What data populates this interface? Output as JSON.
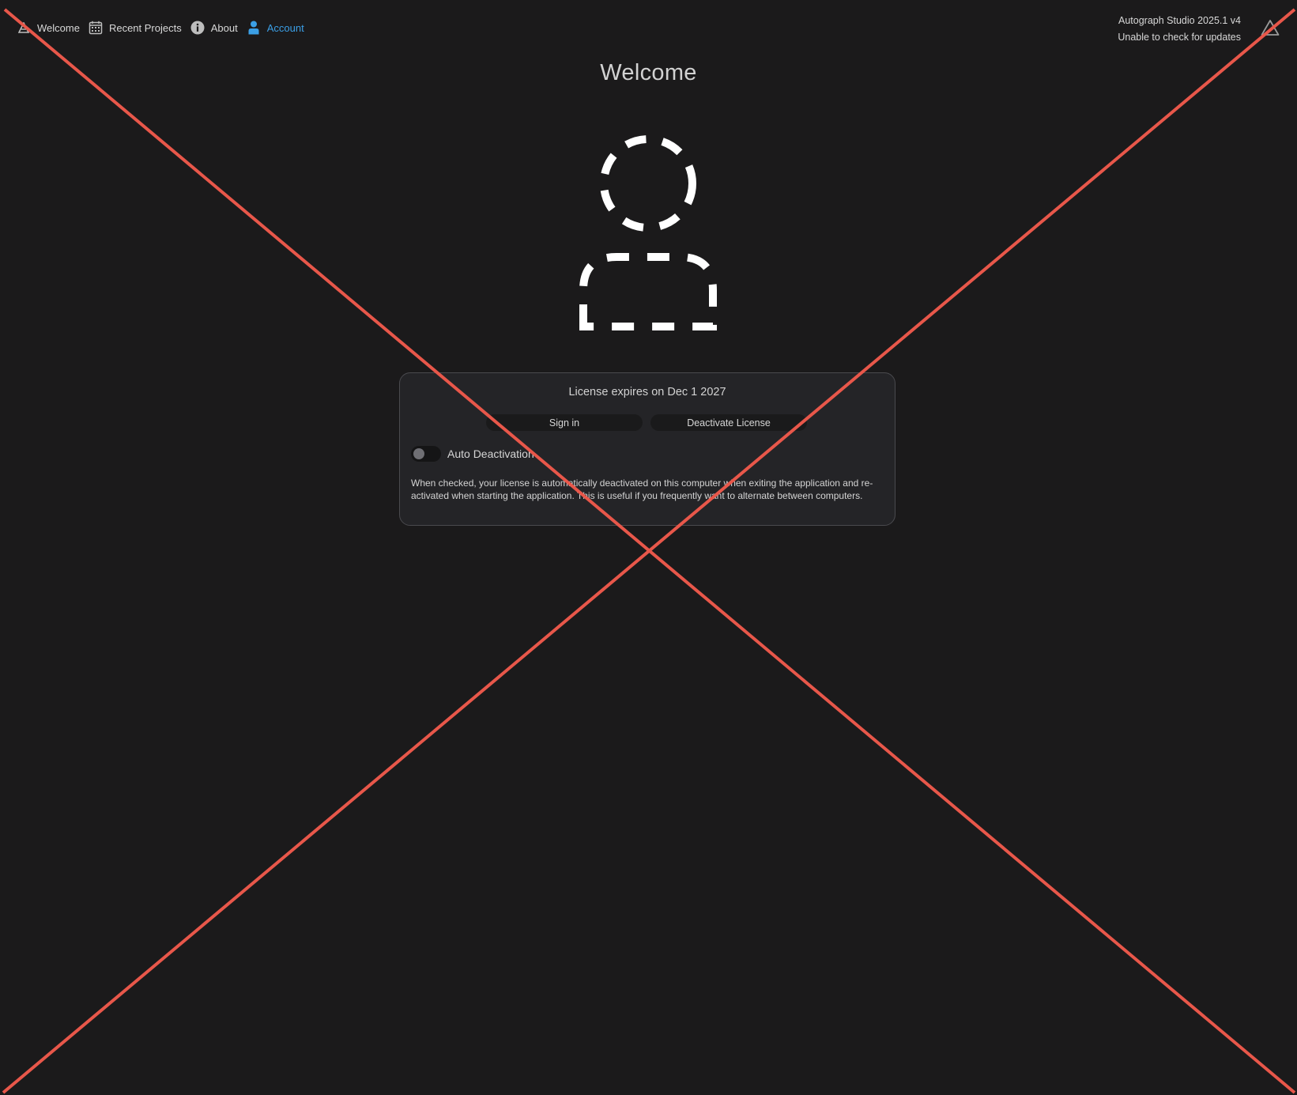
{
  "nav": {
    "items": [
      {
        "label": "Welcome",
        "icon": "app-logo-icon",
        "active": false
      },
      {
        "label": "Recent Projects",
        "icon": "calendar-icon",
        "active": false
      },
      {
        "label": "About",
        "icon": "info-icon",
        "active": false
      },
      {
        "label": "Account",
        "icon": "user-icon",
        "active": true
      }
    ]
  },
  "header": {
    "version": "Autograph Studio 2025.1 v4",
    "update_status": "Unable to check for updates",
    "right_icon": "warning-triangle-icon"
  },
  "main": {
    "title": "Welcome",
    "avatar_icon": "dashed-user-avatar-icon",
    "license": {
      "expires_text": "License expires on Dec 1 2027",
      "sign_in_label": "Sign in",
      "deactivate_label": "Deactivate License",
      "auto_deactivation_label": "Auto Deactivation",
      "auto_deactivation_enabled": false,
      "description": "When checked, your license is automatically deactivated on this computer when exiting the application and re-activated when starting the application. This is useful if you frequently want to alternate between computers."
    }
  },
  "colors": {
    "background": "#1b1a1b",
    "card": "#242427",
    "accent": "#3b9fe6",
    "overlay_cross": "#e8574a"
  }
}
